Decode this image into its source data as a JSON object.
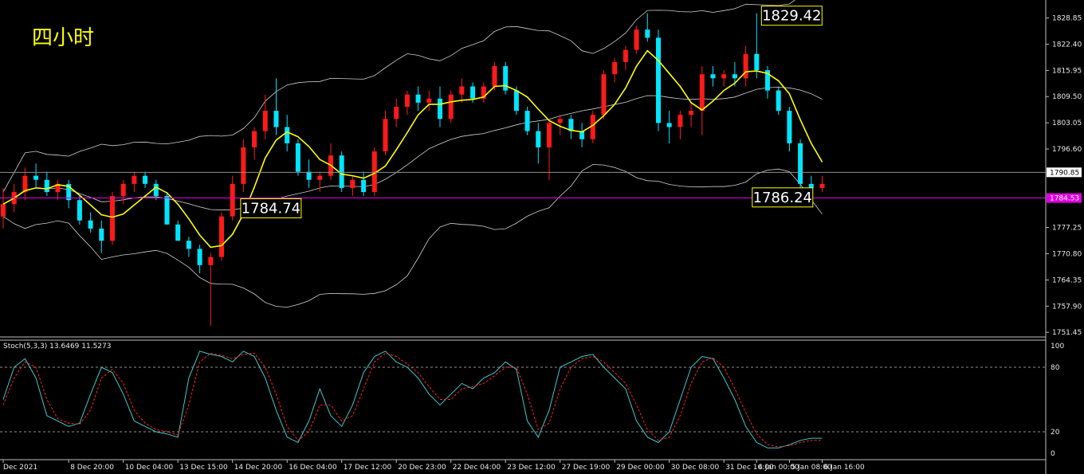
{
  "chart_data": {
    "type": "candlestick",
    "title": "四小时",
    "colors": {
      "background": "#000000",
      "up_candle": "#ff1a1a",
      "down_candle": "#00e5ff",
      "ma_line": "#ffff00",
      "bollinger": "#d0d0d0",
      "current_price_line": "#909090",
      "level_line": "#e000e0",
      "stoch_main": "#40c8d0",
      "stoch_signal": "#ff2020",
      "label_bg": "#000000",
      "label_text": "#ffffff",
      "label_border": "#ffff00",
      "title_color": "#ffff00"
    },
    "price_axis": {
      "ylim": [
        1750.5,
        1832.5
      ],
      "ticks": [
        "1828.85",
        "1822.40",
        "1815.95",
        "1809.50",
        "1803.05",
        "1796.60",
        "1777.25",
        "1770.80",
        "1764.35",
        "1757.90",
        "1751.45"
      ],
      "current_price": "1790.85",
      "level_price": "1784.53"
    },
    "annotations": [
      {
        "text": "1829.42",
        "bar": 69,
        "price": 1829.42
      },
      {
        "text": "1784.74",
        "bar": 27,
        "price": 1784.74
      },
      {
        "text": "1786.24",
        "bar": 74,
        "price": 1786.24
      }
    ],
    "candles": [
      [
        1780.0,
        1787.0,
        1777.0,
        1783.0
      ],
      [
        1783.0,
        1788.0,
        1781.0,
        1786.0
      ],
      [
        1786.0,
        1792.0,
        1784.0,
        1790.0
      ],
      [
        1790.0,
        1793.0,
        1787.0,
        1789.0
      ],
      [
        1789.0,
        1791.0,
        1785.0,
        1786.0
      ],
      [
        1786.0,
        1789.0,
        1784.0,
        1788.0
      ],
      [
        1788.0,
        1789.0,
        1782.0,
        1784.0
      ],
      [
        1784.0,
        1785.0,
        1778.0,
        1779.0
      ],
      [
        1779.0,
        1781.0,
        1776.0,
        1777.0
      ],
      [
        1777.0,
        1779.0,
        1771.0,
        1774.0
      ],
      [
        1774.0,
        1786.0,
        1773.0,
        1785.0
      ],
      [
        1785.0,
        1789.0,
        1783.0,
        1788.0
      ],
      [
        1788.0,
        1791.0,
        1786.0,
        1790.0
      ],
      [
        1790.0,
        1791.0,
        1787.0,
        1788.0
      ],
      [
        1788.0,
        1789.0,
        1784.0,
        1785.0
      ],
      [
        1785.0,
        1786.0,
        1778.0,
        1778.0
      ],
      [
        1778.0,
        1779.0,
        1774.0,
        1774.0
      ],
      [
        1774.0,
        1775.0,
        1770.0,
        1772.0
      ],
      [
        1772.0,
        1773.0,
        1766.0,
        1768.0
      ],
      [
        1768.0,
        1771.0,
        1753.0,
        1770.0
      ],
      [
        1770.0,
        1781.0,
        1769.0,
        1780.0
      ],
      [
        1780.0,
        1790.0,
        1779.0,
        1788.0
      ],
      [
        1788.0,
        1799.0,
        1786.0,
        1797.0
      ],
      [
        1797.0,
        1802.0,
        1794.0,
        1801.0
      ],
      [
        1801.0,
        1810.0,
        1799.0,
        1806.0
      ],
      [
        1806.0,
        1814.0,
        1800.0,
        1802.0
      ],
      [
        1802.0,
        1805.0,
        1796.0,
        1798.0
      ],
      [
        1798.0,
        1799.0,
        1790.0,
        1791.0
      ],
      [
        1791.0,
        1794.0,
        1787.0,
        1789.0
      ],
      [
        1789.0,
        1791.0,
        1786.0,
        1790.0
      ],
      [
        1790.0,
        1798.0,
        1789.0,
        1795.0
      ],
      [
        1795.0,
        1796.0,
        1786.0,
        1787.0
      ],
      [
        1787.0,
        1790.0,
        1785.0,
        1789.0
      ],
      [
        1789.0,
        1791.0,
        1785.0,
        1786.0
      ],
      [
        1786.0,
        1797.0,
        1785.0,
        1796.0
      ],
      [
        1796.0,
        1806.0,
        1795.0,
        1804.0
      ],
      [
        1804.0,
        1809.0,
        1802.0,
        1807.0
      ],
      [
        1807.0,
        1811.0,
        1805.0,
        1810.0
      ],
      [
        1810.0,
        1812.0,
        1806.0,
        1808.0
      ],
      [
        1808.0,
        1811.0,
        1806.0,
        1809.0
      ],
      [
        1809.0,
        1812.0,
        1802.0,
        1804.0
      ],
      [
        1804.0,
        1811.0,
        1803.0,
        1810.0
      ],
      [
        1810.0,
        1814.0,
        1808.0,
        1812.0
      ],
      [
        1812.0,
        1813.0,
        1808.0,
        1809.0
      ],
      [
        1809.0,
        1813.0,
        1808.0,
        1812.0
      ],
      [
        1812.0,
        1818.0,
        1811.0,
        1817.0
      ],
      [
        1817.0,
        1818.0,
        1810.0,
        1811.0
      ],
      [
        1811.0,
        1812.0,
        1805.0,
        1806.0
      ],
      [
        1806.0,
        1807.0,
        1800.0,
        1801.0
      ],
      [
        1801.0,
        1803.0,
        1793.0,
        1797.0
      ],
      [
        1797.0,
        1804.0,
        1789.0,
        1803.0
      ],
      [
        1803.0,
        1805.0,
        1800.0,
        1804.0
      ],
      [
        1804.0,
        1805.0,
        1799.0,
        1801.0
      ],
      [
        1801.0,
        1803.0,
        1797.0,
        1799.0
      ],
      [
        1799.0,
        1806.0,
        1798.0,
        1805.0
      ],
      [
        1805.0,
        1816.0,
        1804.0,
        1815.0
      ],
      [
        1815.0,
        1819.0,
        1813.0,
        1818.0
      ],
      [
        1818.0,
        1822.0,
        1816.0,
        1821.0
      ],
      [
        1821.0,
        1827.0,
        1820.0,
        1826.0
      ],
      [
        1826.0,
        1830.0,
        1823.0,
        1824.0
      ],
      [
        1824.0,
        1826.0,
        1801.0,
        1803.0
      ],
      [
        1803.0,
        1806.0,
        1798.0,
        1802.0
      ],
      [
        1802.0,
        1806.0,
        1799.0,
        1805.0
      ],
      [
        1805.0,
        1808.0,
        1802.0,
        1806.0
      ],
      [
        1806.0,
        1817.0,
        1800.0,
        1815.0
      ],
      [
        1815.0,
        1817.0,
        1812.0,
        1814.0
      ],
      [
        1814.0,
        1816.0,
        1812.0,
        1815.0
      ],
      [
        1815.0,
        1818.0,
        1812.0,
        1814.0
      ],
      [
        1814.0,
        1822.0,
        1812.0,
        1820.0
      ],
      [
        1820.0,
        1830.0,
        1814.0,
        1816.0
      ],
      [
        1816.0,
        1817.0,
        1809.0,
        1811.0
      ],
      [
        1811.0,
        1812.0,
        1805.0,
        1806.0
      ],
      [
        1806.0,
        1807.0,
        1796.0,
        1798.0
      ],
      [
        1798.0,
        1799.0,
        1786.0,
        1788.0
      ],
      [
        1788.0,
        1790.0,
        1786.0,
        1787.0
      ],
      [
        1787.0,
        1790.0,
        1786.0,
        1788.0
      ]
    ],
    "stochastic": {
      "label": "Stoch(5,3,3) 13.6469 11.5273",
      "ylim": [
        0,
        100
      ],
      "ticks": [
        "100",
        "80",
        "20",
        "0"
      ],
      "levels": [
        80,
        20
      ],
      "main": [
        50,
        80,
        88,
        70,
        35,
        30,
        25,
        28,
        55,
        80,
        75,
        55,
        30,
        25,
        20,
        18,
        15,
        70,
        95,
        92,
        90,
        85,
        95,
        90,
        70,
        40,
        15,
        10,
        30,
        60,
        35,
        25,
        45,
        75,
        90,
        95,
        85,
        80,
        70,
        55,
        45,
        55,
        65,
        60,
        70,
        75,
        85,
        78,
        30,
        15,
        40,
        80,
        85,
        90,
        92,
        80,
        70,
        60,
        30,
        15,
        10,
        20,
        50,
        80,
        90,
        88,
        70,
        50,
        25,
        10,
        5,
        5,
        8,
        12,
        14,
        14
      ],
      "signal": [
        45,
        70,
        85,
        80,
        50,
        32,
        28,
        27,
        40,
        70,
        78,
        65,
        40,
        28,
        22,
        20,
        17,
        45,
        85,
        93,
        91,
        88,
        92,
        93,
        80,
        55,
        25,
        12,
        20,
        45,
        45,
        30,
        35,
        60,
        85,
        93,
        90,
        83,
        75,
        62,
        50,
        50,
        60,
        62,
        65,
        72,
        80,
        80,
        55,
        22,
        28,
        60,
        80,
        88,
        90,
        85,
        75,
        65,
        45,
        22,
        12,
        15,
        35,
        65,
        85,
        89,
        80,
        60,
        38,
        18,
        8,
        6,
        7,
        10,
        12,
        12
      ]
    },
    "time_axis": {
      "labels": [
        {
          "text": "Dec 2021",
          "bar": 0
        },
        {
          "text": "8 Dec 20:00",
          "bar": 6
        },
        {
          "text": "10 Dec 04:00",
          "bar": 11
        },
        {
          "text": "13 Dec 15:00",
          "bar": 16
        },
        {
          "text": "14 Dec 20:00",
          "bar": 21
        },
        {
          "text": "16 Dec 04:00",
          "bar": 26
        },
        {
          "text": "17 Dec 12:00",
          "bar": 31
        },
        {
          "text": "20 Dec 23:00",
          "bar": 36
        },
        {
          "text": "22 Dec 04:00",
          "bar": 41
        },
        {
          "text": "23 Dec 12:00",
          "bar": 46
        },
        {
          "text": "27 Dec 19:00",
          "bar": 51
        },
        {
          "text": "29 Dec 00:00",
          "bar": 56
        },
        {
          "text": "30 Dec 08:00",
          "bar": 61
        },
        {
          "text": "31 Dec 16:00",
          "bar": 66
        },
        {
          "text": "4 Jan 00:00",
          "bar": 69
        },
        {
          "text": "5 Jan 08:00",
          "bar": 72
        },
        {
          "text": "6 Jan 16:00",
          "bar": 75
        }
      ]
    }
  }
}
